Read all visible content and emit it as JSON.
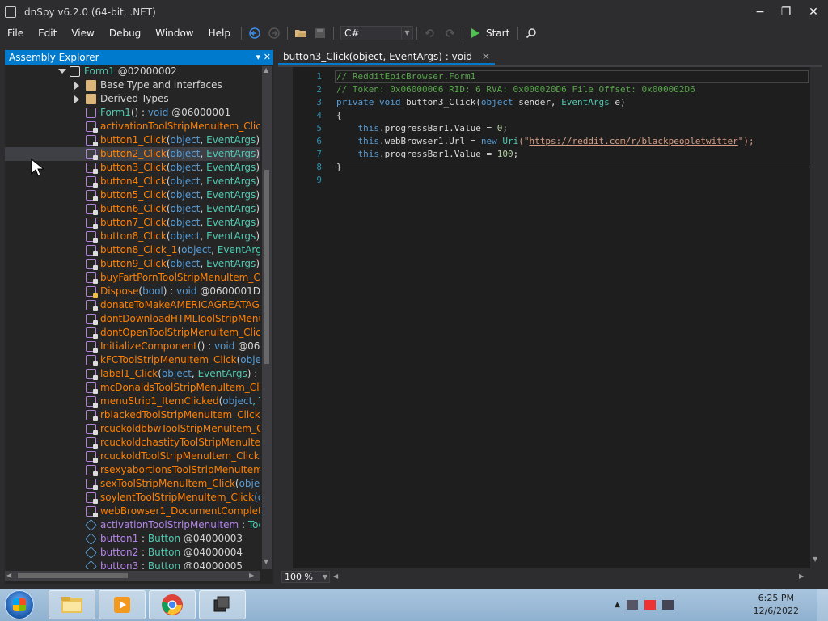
{
  "window": {
    "title": "dnSpy v6.2.0 (64-bit, .NET)",
    "controls": {
      "minimize": "−",
      "maximize": "❐",
      "close": "✕"
    }
  },
  "menubar": {
    "items": [
      "File",
      "Edit",
      "View",
      "Debug",
      "Window",
      "Help"
    ],
    "language": "C#",
    "start_label": "Start"
  },
  "explorer": {
    "title": "Assembly Explorer",
    "pin": "▾",
    "close": "✕",
    "rows": [
      {
        "indent": 1,
        "icon": "class-icon",
        "expander": "down",
        "parts": [
          {
            "t": "Form1",
            "c": "c-type"
          },
          {
            "t": " @02000002",
            "c": "c-gray"
          }
        ]
      },
      {
        "indent": 2,
        "icon": "folder-icon",
        "expander": "right",
        "parts": [
          {
            "t": "Base Type and Interfaces",
            "c": "c-gray"
          }
        ]
      },
      {
        "indent": 2,
        "icon": "folder-icon",
        "expander": "right",
        "parts": [
          {
            "t": "Derived Types",
            "c": "c-gray"
          }
        ]
      },
      {
        "indent": 2,
        "icon": "method-icon",
        "parts": [
          {
            "t": "Form1",
            "c": "c-ctor"
          },
          {
            "t": "() : ",
            "c": "c-gray"
          },
          {
            "t": "void",
            "c": "c-kw"
          },
          {
            "t": " @06000001",
            "c": "c-gray"
          }
        ]
      },
      {
        "indent": 2,
        "icon": "private-method-icon",
        "parts": [
          {
            "t": "activationToolStripMenuItem_Click",
            "c": "c-method"
          },
          {
            "t": "(ol",
            "c": "c-kw"
          }
        ]
      },
      {
        "indent": 2,
        "icon": "private-method-icon",
        "parts": [
          {
            "t": "button1_Click",
            "c": "c-method"
          },
          {
            "t": "(",
            "c": "c-gray"
          },
          {
            "t": "object",
            "c": "c-kw"
          },
          {
            "t": ", ",
            "c": "c-gray"
          },
          {
            "t": "EventArgs",
            "c": "c-type"
          },
          {
            "t": ") : ",
            "c": "c-gray"
          },
          {
            "t": "voi",
            "c": "c-kw"
          }
        ]
      },
      {
        "indent": 2,
        "icon": "private-method-icon",
        "selected": true,
        "parts": [
          {
            "t": "button2_Click",
            "c": "c-method"
          },
          {
            "t": "(",
            "c": "c-gray"
          },
          {
            "t": "object",
            "c": "c-kw"
          },
          {
            "t": ", ",
            "c": "c-gray"
          },
          {
            "t": "EventArgs",
            "c": "c-type"
          },
          {
            "t": ") : ",
            "c": "c-gray"
          },
          {
            "t": "voi",
            "c": "c-kw"
          }
        ]
      },
      {
        "indent": 2,
        "icon": "private-method-icon",
        "parts": [
          {
            "t": "button3_Click",
            "c": "c-method"
          },
          {
            "t": "(",
            "c": "c-gray"
          },
          {
            "t": "object",
            "c": "c-kw"
          },
          {
            "t": ", ",
            "c": "c-gray"
          },
          {
            "t": "EventArgs",
            "c": "c-type"
          },
          {
            "t": ") : ",
            "c": "c-gray"
          },
          {
            "t": "voi",
            "c": "c-kw"
          }
        ]
      },
      {
        "indent": 2,
        "icon": "private-method-icon",
        "parts": [
          {
            "t": "button4_Click",
            "c": "c-method"
          },
          {
            "t": "(",
            "c": "c-gray"
          },
          {
            "t": "object",
            "c": "c-kw"
          },
          {
            "t": ", ",
            "c": "c-gray"
          },
          {
            "t": "EventArgs",
            "c": "c-type"
          },
          {
            "t": ") : ",
            "c": "c-gray"
          },
          {
            "t": "voi",
            "c": "c-kw"
          }
        ]
      },
      {
        "indent": 2,
        "icon": "private-method-icon",
        "parts": [
          {
            "t": "button5_Click",
            "c": "c-method"
          },
          {
            "t": "(",
            "c": "c-gray"
          },
          {
            "t": "object",
            "c": "c-kw"
          },
          {
            "t": ", ",
            "c": "c-gray"
          },
          {
            "t": "EventArgs",
            "c": "c-type"
          },
          {
            "t": ") : ",
            "c": "c-gray"
          },
          {
            "t": "voi",
            "c": "c-kw"
          }
        ]
      },
      {
        "indent": 2,
        "icon": "private-method-icon",
        "parts": [
          {
            "t": "button6_Click",
            "c": "c-method"
          },
          {
            "t": "(",
            "c": "c-gray"
          },
          {
            "t": "object",
            "c": "c-kw"
          },
          {
            "t": ", ",
            "c": "c-gray"
          },
          {
            "t": "EventArgs",
            "c": "c-type"
          },
          {
            "t": ") : ",
            "c": "c-gray"
          },
          {
            "t": "voi",
            "c": "c-kw"
          }
        ]
      },
      {
        "indent": 2,
        "icon": "private-method-icon",
        "parts": [
          {
            "t": "button7_Click",
            "c": "c-method"
          },
          {
            "t": "(",
            "c": "c-gray"
          },
          {
            "t": "object",
            "c": "c-kw"
          },
          {
            "t": ", ",
            "c": "c-gray"
          },
          {
            "t": "EventArgs",
            "c": "c-type"
          },
          {
            "t": ") : ",
            "c": "c-gray"
          },
          {
            "t": "voi",
            "c": "c-kw"
          }
        ]
      },
      {
        "indent": 2,
        "icon": "private-method-icon",
        "parts": [
          {
            "t": "button8_Click",
            "c": "c-method"
          },
          {
            "t": "(",
            "c": "c-gray"
          },
          {
            "t": "object",
            "c": "c-kw"
          },
          {
            "t": ", ",
            "c": "c-gray"
          },
          {
            "t": "EventArgs",
            "c": "c-type"
          },
          {
            "t": ") : ",
            "c": "c-gray"
          },
          {
            "t": "voi",
            "c": "c-kw"
          }
        ]
      },
      {
        "indent": 2,
        "icon": "private-method-icon",
        "parts": [
          {
            "t": "button8_Click_1",
            "c": "c-method"
          },
          {
            "t": "(",
            "c": "c-gray"
          },
          {
            "t": "object",
            "c": "c-kw"
          },
          {
            "t": ", ",
            "c": "c-gray"
          },
          {
            "t": "EventArgs",
            "c": "c-type"
          },
          {
            "t": ") : v",
            "c": "c-gray"
          }
        ]
      },
      {
        "indent": 2,
        "icon": "private-method-icon",
        "parts": [
          {
            "t": "button9_Click",
            "c": "c-method"
          },
          {
            "t": "(",
            "c": "c-gray"
          },
          {
            "t": "object",
            "c": "c-kw"
          },
          {
            "t": ", ",
            "c": "c-gray"
          },
          {
            "t": "EventArgs",
            "c": "c-type"
          },
          {
            "t": ") : ",
            "c": "c-gray"
          },
          {
            "t": "voi",
            "c": "c-kw"
          }
        ]
      },
      {
        "indent": 2,
        "icon": "private-method-icon",
        "parts": [
          {
            "t": "buyFartPornToolStripMenuItem_Click",
            "c": "c-method"
          }
        ]
      },
      {
        "indent": 2,
        "icon": "protected-method-icon",
        "parts": [
          {
            "t": "Dispose",
            "c": "c-method"
          },
          {
            "t": "(",
            "c": "c-gray"
          },
          {
            "t": "bool",
            "c": "c-kw"
          },
          {
            "t": ") : ",
            "c": "c-gray"
          },
          {
            "t": "void",
            "c": "c-kw"
          },
          {
            "t": " @0600001D",
            "c": "c-gray"
          }
        ]
      },
      {
        "indent": 2,
        "icon": "private-method-icon",
        "parts": [
          {
            "t": "donateToMakeAMERICAGREATAGAIN",
            "c": "c-method"
          }
        ]
      },
      {
        "indent": 2,
        "icon": "private-method-icon",
        "parts": [
          {
            "t": "dontDownloadHTMLToolStripMenuIte",
            "c": "c-method"
          }
        ]
      },
      {
        "indent": 2,
        "icon": "private-method-icon",
        "parts": [
          {
            "t": "dontOpenToolStripMenuItem_Click",
            "c": "c-method"
          },
          {
            "t": "(o",
            "c": "c-kw"
          }
        ]
      },
      {
        "indent": 2,
        "icon": "private-method-icon",
        "parts": [
          {
            "t": "InitializeComponent",
            "c": "c-method"
          },
          {
            "t": "() : ",
            "c": "c-gray"
          },
          {
            "t": "void",
            "c": "c-kw"
          },
          {
            "t": " @0600001",
            "c": "c-gray"
          }
        ]
      },
      {
        "indent": 2,
        "icon": "private-method-icon",
        "parts": [
          {
            "t": "kFCToolStripMenuItem_Click",
            "c": "c-method"
          },
          {
            "t": "(",
            "c": "c-gray"
          },
          {
            "t": "object",
            "c": "c-kw"
          },
          {
            "t": ", E",
            "c": "c-type"
          }
        ]
      },
      {
        "indent": 2,
        "icon": "private-method-icon",
        "parts": [
          {
            "t": "label1_Click",
            "c": "c-method"
          },
          {
            "t": "(",
            "c": "c-gray"
          },
          {
            "t": "object",
            "c": "c-kw"
          },
          {
            "t": ", ",
            "c": "c-gray"
          },
          {
            "t": "EventArgs",
            "c": "c-type"
          },
          {
            "t": ") : ",
            "c": "c-gray"
          },
          {
            "t": "void",
            "c": "c-kw"
          },
          {
            "t": " @",
            "c": "c-gray"
          }
        ]
      },
      {
        "indent": 2,
        "icon": "private-method-icon",
        "parts": [
          {
            "t": "mcDonaldsToolStripMenuItem_Click",
            "c": "c-method"
          },
          {
            "t": "(",
            "c": "c-gray"
          }
        ]
      },
      {
        "indent": 2,
        "icon": "private-method-icon",
        "parts": [
          {
            "t": "menuStrip1_ItemClicked",
            "c": "c-method"
          },
          {
            "t": "(",
            "c": "c-gray"
          },
          {
            "t": "object",
            "c": "c-kw"
          },
          {
            "t": ", ToolS",
            "c": "c-type"
          }
        ]
      },
      {
        "indent": 2,
        "icon": "private-method-icon",
        "parts": [
          {
            "t": "rblackedToolStripMenuItem_Click",
            "c": "c-method"
          },
          {
            "t": "(obj",
            "c": "c-kw"
          }
        ]
      },
      {
        "indent": 2,
        "icon": "private-method-icon",
        "parts": [
          {
            "t": "rcuckoldbbwToolStripMenuItem_Click",
            "c": "c-method"
          }
        ]
      },
      {
        "indent": 2,
        "icon": "private-method-icon",
        "parts": [
          {
            "t": "rcuckoldchastityToolStripMenuItem_C",
            "c": "c-method"
          }
        ]
      },
      {
        "indent": 2,
        "icon": "private-method-icon",
        "parts": [
          {
            "t": "rcuckoldToolStripMenuItem_Click",
            "c": "c-method"
          },
          {
            "t": "(obj",
            "c": "c-kw"
          }
        ]
      },
      {
        "indent": 2,
        "icon": "private-method-icon",
        "parts": [
          {
            "t": "rsexyabortionsToolStripMenuItem_Clic",
            "c": "c-method"
          }
        ]
      },
      {
        "indent": 2,
        "icon": "private-method-icon",
        "parts": [
          {
            "t": "sexToolStripMenuItem_Click",
            "c": "c-method"
          },
          {
            "t": "(",
            "c": "c-gray"
          },
          {
            "t": "object",
            "c": "c-kw"
          },
          {
            "t": ", E",
            "c": "c-type"
          }
        ]
      },
      {
        "indent": 2,
        "icon": "private-method-icon",
        "parts": [
          {
            "t": "soylentToolStripMenuItem_Click",
            "c": "c-method"
          },
          {
            "t": "(obje",
            "c": "c-kw"
          }
        ]
      },
      {
        "indent": 2,
        "icon": "private-method-icon",
        "parts": [
          {
            "t": "webBrowser1_DocumentCompleted",
            "c": "c-method"
          },
          {
            "t": "(o",
            "c": "c-kw"
          }
        ]
      },
      {
        "indent": 2,
        "icon": "field-icon",
        "parts": [
          {
            "t": "activationToolStripMenuItem",
            "c": "c-field"
          },
          {
            "t": " : ",
            "c": "c-gray"
          },
          {
            "t": "ToolStr",
            "c": "c-type"
          }
        ]
      },
      {
        "indent": 2,
        "icon": "field-icon",
        "parts": [
          {
            "t": "button1",
            "c": "c-field"
          },
          {
            "t": " : ",
            "c": "c-gray"
          },
          {
            "t": "Button",
            "c": "c-type"
          },
          {
            "t": " @04000003",
            "c": "c-gray"
          }
        ]
      },
      {
        "indent": 2,
        "icon": "field-icon",
        "parts": [
          {
            "t": "button2",
            "c": "c-field"
          },
          {
            "t": " : ",
            "c": "c-gray"
          },
          {
            "t": "Button",
            "c": "c-type"
          },
          {
            "t": " @04000004",
            "c": "c-gray"
          }
        ]
      },
      {
        "indent": 2,
        "icon": "field-icon",
        "parts": [
          {
            "t": "button3",
            "c": "c-field"
          },
          {
            "t": " : ",
            "c": "c-gray"
          },
          {
            "t": "Button",
            "c": "c-type"
          },
          {
            "t": " @04000005",
            "c": "c-gray"
          }
        ]
      }
    ]
  },
  "editor": {
    "tab_label": "button3_Click(object, EventArgs) : void",
    "tab_close": "✕",
    "zoom": "100 %",
    "line_numbers": [
      "1",
      "2",
      "3",
      "4",
      "5",
      "6",
      "7",
      "8",
      "9"
    ],
    "lines": [
      [
        {
          "t": "// ",
          "c": "comment"
        },
        {
          "t": "RedditEpicBrowser.Form1",
          "c": "comment"
        }
      ],
      [
        {
          "t": "// Token: 0x06000006 RID: 6 RVA: 0x000020D6 File Offset: 0x000002D6",
          "c": "comment"
        }
      ],
      [
        {
          "t": "private",
          "c": "kw"
        },
        {
          "t": " ",
          "c": "plain"
        },
        {
          "t": "void",
          "c": "kw"
        },
        {
          "t": " button3_Click(",
          "c": "mth"
        },
        {
          "t": "object",
          "c": "kw"
        },
        {
          "t": " sender, ",
          "c": "param"
        },
        {
          "t": "EventArgs",
          "c": "ty"
        },
        {
          "t": " e)",
          "c": "param"
        }
      ],
      [
        {
          "t": "{",
          "c": "plain"
        }
      ],
      [
        {
          "t": "    ",
          "c": "plain"
        },
        {
          "t": "this",
          "c": "kw"
        },
        {
          "t": ".progressBar1.",
          "c": "prop"
        },
        {
          "t": "Value",
          "c": "prop"
        },
        {
          "t": " = ",
          "c": "plain"
        },
        {
          "t": "0",
          "c": "num"
        },
        {
          "t": ";",
          "c": "plain"
        }
      ],
      [
        {
          "t": "    ",
          "c": "plain"
        },
        {
          "t": "this",
          "c": "kw"
        },
        {
          "t": ".webBrowser1.",
          "c": "prop"
        },
        {
          "t": "Url",
          "c": "prop"
        },
        {
          "t": " = ",
          "c": "plain"
        },
        {
          "t": "new",
          "c": "kw"
        },
        {
          "t": " ",
          "c": "plain"
        },
        {
          "t": "Uri",
          "c": "ty"
        },
        {
          "t": "(\"",
          "c": "str"
        },
        {
          "t": "https://reddit.com/r/blackpeopletwitter",
          "c": "link"
        },
        {
          "t": "\");",
          "c": "str"
        }
      ],
      [
        {
          "t": "    ",
          "c": "plain"
        },
        {
          "t": "this",
          "c": "kw"
        },
        {
          "t": ".progressBar1.",
          "c": "prop"
        },
        {
          "t": "Value",
          "c": "prop"
        },
        {
          "t": " = ",
          "c": "plain"
        },
        {
          "t": "100",
          "c": "num"
        },
        {
          "t": ";",
          "c": "plain"
        }
      ],
      [
        {
          "t": "}",
          "c": "plain"
        }
      ],
      []
    ]
  },
  "taskbar": {
    "time": "6:25 PM",
    "date": "12/6/2022"
  }
}
